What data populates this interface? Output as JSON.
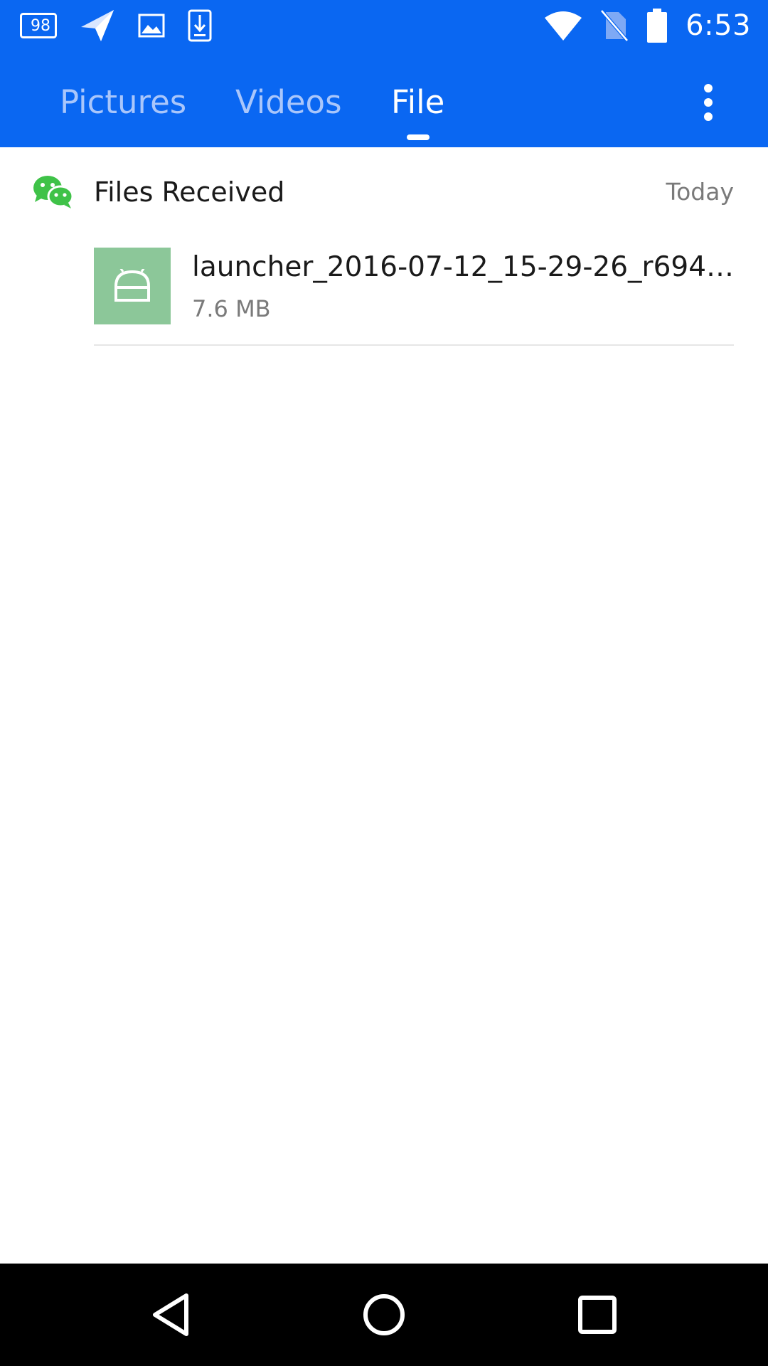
{
  "status_bar": {
    "notification_badge": "98",
    "time": "6:53",
    "left_icons": [
      "notification-count-icon",
      "send-arrow-icon",
      "image-icon",
      "download-icon"
    ],
    "right_icons": [
      "wifi-icon",
      "no-sim-icon",
      "battery-icon"
    ]
  },
  "tabs": [
    {
      "label": "Pictures",
      "active": false
    },
    {
      "label": "Videos",
      "active": false
    },
    {
      "label": "File",
      "active": true
    }
  ],
  "section": {
    "title": "Files Received",
    "date": "Today",
    "icon": "wechat-icon"
  },
  "files": [
    {
      "name": "launcher_2016-07-12_15-29-26_r6948…",
      "size": "7.6 MB",
      "icon": "android-apk-icon"
    }
  ],
  "nav_bar": {
    "buttons": [
      "back-icon",
      "home-icon",
      "recents-icon"
    ]
  },
  "colors": {
    "app_bar": "#0a67f2",
    "tab_inactive": "#a9c6fb",
    "tab_active": "#ffffff",
    "wechat_green": "#3fc248",
    "file_thumb": "#8cc799",
    "nav_bar": "#000000"
  }
}
